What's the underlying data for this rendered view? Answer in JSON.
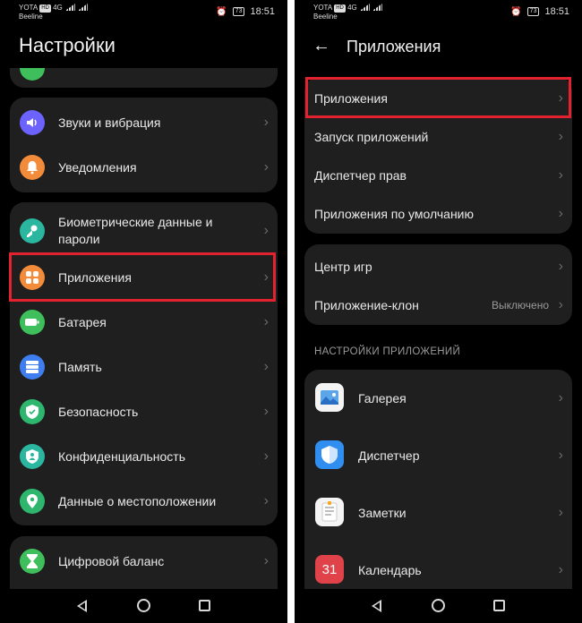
{
  "status_bar": {
    "carrier1": "YOTA",
    "badge": "HD",
    "net": "4G",
    "carrier2": "Beeline",
    "battery": "73",
    "time": "18:51"
  },
  "left": {
    "title": "Настройки",
    "group1": [
      {
        "label": "Звуки и вибрация",
        "icon": "sound-icon",
        "color": "#6c63ff"
      },
      {
        "label": "Уведомления",
        "icon": "bell-icon",
        "color": "#f28c3a"
      }
    ],
    "group2": [
      {
        "label": "Биометрические данные и пароли",
        "icon": "key-icon",
        "color": "#2bb6a0"
      },
      {
        "label": "Приложения",
        "icon": "apps-icon",
        "color": "#f28c3a"
      },
      {
        "label": "Батарея",
        "icon": "battery-icon",
        "color": "#3fbf5b"
      },
      {
        "label": "Память",
        "icon": "storage-icon",
        "color": "#3f7ef0"
      },
      {
        "label": "Безопасность",
        "icon": "shield-icon",
        "color": "#2fb66e"
      },
      {
        "label": "Конфиденциальность",
        "icon": "privacy-icon",
        "color": "#2bb6a0"
      },
      {
        "label": "Данные о местоположении",
        "icon": "location-icon",
        "color": "#2fb66e"
      }
    ],
    "group3": [
      {
        "label": "Цифровой баланс",
        "icon": "hourglass-icon",
        "color": "#3fbf5b"
      }
    ]
  },
  "right": {
    "title": "Приложения",
    "group1": [
      {
        "label": "Приложения"
      },
      {
        "label": "Запуск приложений"
      },
      {
        "label": "Диспетчер прав"
      },
      {
        "label": "Приложения по умолчанию"
      }
    ],
    "group2": [
      {
        "label": "Центр игр",
        "value": ""
      },
      {
        "label": "Приложение-клон",
        "value": "Выключено"
      }
    ],
    "section_header": "НАСТРОЙКИ ПРИЛОЖЕНИЙ",
    "apps": [
      {
        "label": "Галерея",
        "icon": "gallery-icon"
      },
      {
        "label": "Диспетчер",
        "icon": "phone-manager-icon"
      },
      {
        "label": "Заметки",
        "icon": "notes-icon"
      },
      {
        "label": "Календарь",
        "icon": "calendar-icon",
        "icon_text": "31"
      }
    ]
  },
  "colors": {
    "highlight": "#e3222f",
    "card": "#1f1f1f",
    "background": "#000000"
  }
}
